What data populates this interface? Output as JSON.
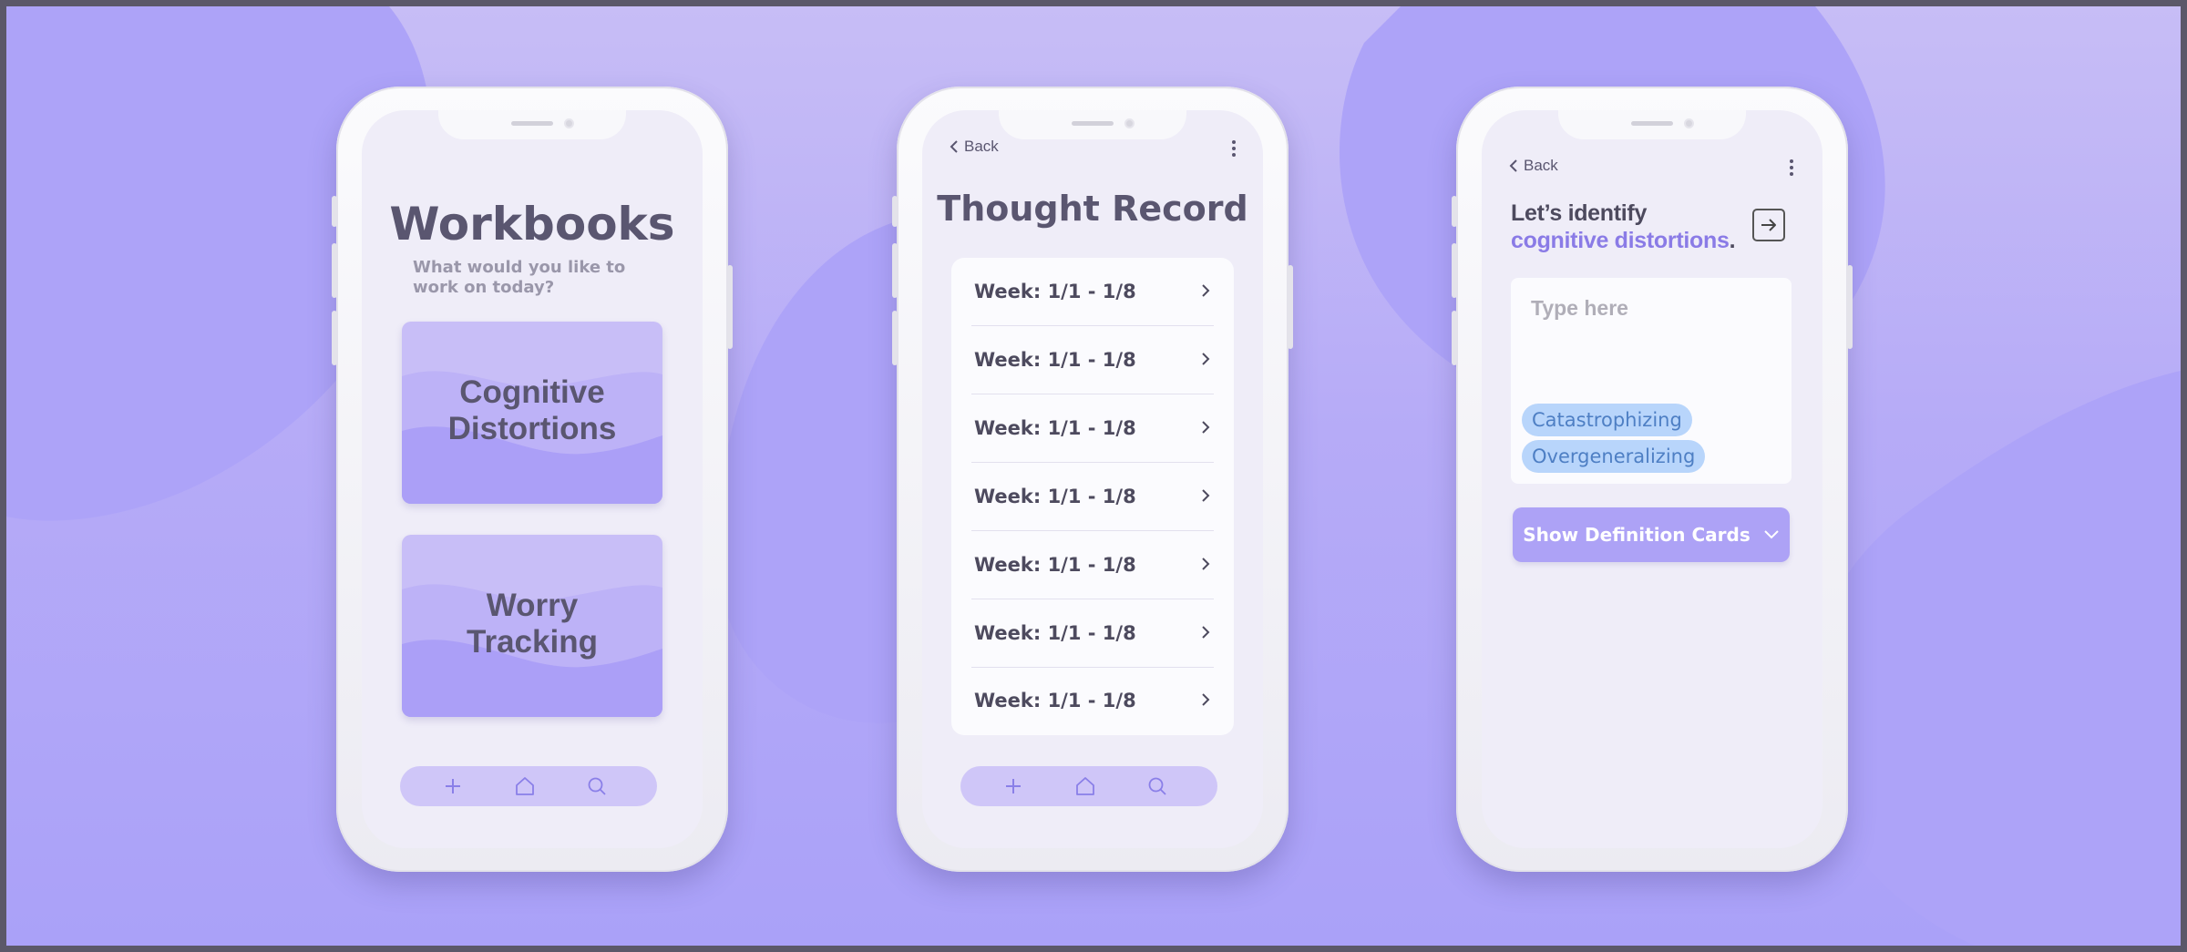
{
  "colors": {
    "background": "#b6abf7",
    "blob": "#aaa1f8",
    "accent": "#8a7be6",
    "title_text": "#5a5670",
    "chip_bg": "#b8d5fb",
    "chip_text": "#4e7fc4",
    "button_bg": "#ada2f6"
  },
  "workbooks": {
    "title": "Workbooks",
    "subtitle": "What would you like to work on today?",
    "cards": [
      {
        "label": "Cognitive Distortions"
      },
      {
        "label": "Worry Tracking"
      }
    ],
    "nav": {
      "icons": [
        "plus-icon",
        "home-icon",
        "search-icon"
      ]
    }
  },
  "thought_record": {
    "back_label": "Back",
    "title": "Thought Record",
    "rows": [
      {
        "label": "Week: 1/1 - 1/8"
      },
      {
        "label": "Week: 1/1 - 1/8"
      },
      {
        "label": "Week: 1/1 - 1/8"
      },
      {
        "label": "Week: 1/1 - 1/8"
      },
      {
        "label": "Week: 1/1 - 1/8"
      },
      {
        "label": "Week: 1/1 - 1/8"
      },
      {
        "label": "Week: 1/1 - 1/8"
      }
    ],
    "nav": {
      "icons": [
        "plus-icon",
        "home-icon",
        "search-icon"
      ]
    }
  },
  "identify": {
    "back_label": "Back",
    "heading_prefix": "Let’s identify ",
    "heading_accent": "cognitive distortions",
    "heading_suffix": ".",
    "input_placeholder": "Type here",
    "chips": [
      "Catastrophizing",
      "Overgeneralizing"
    ],
    "button_label": "Show Definition Cards"
  }
}
